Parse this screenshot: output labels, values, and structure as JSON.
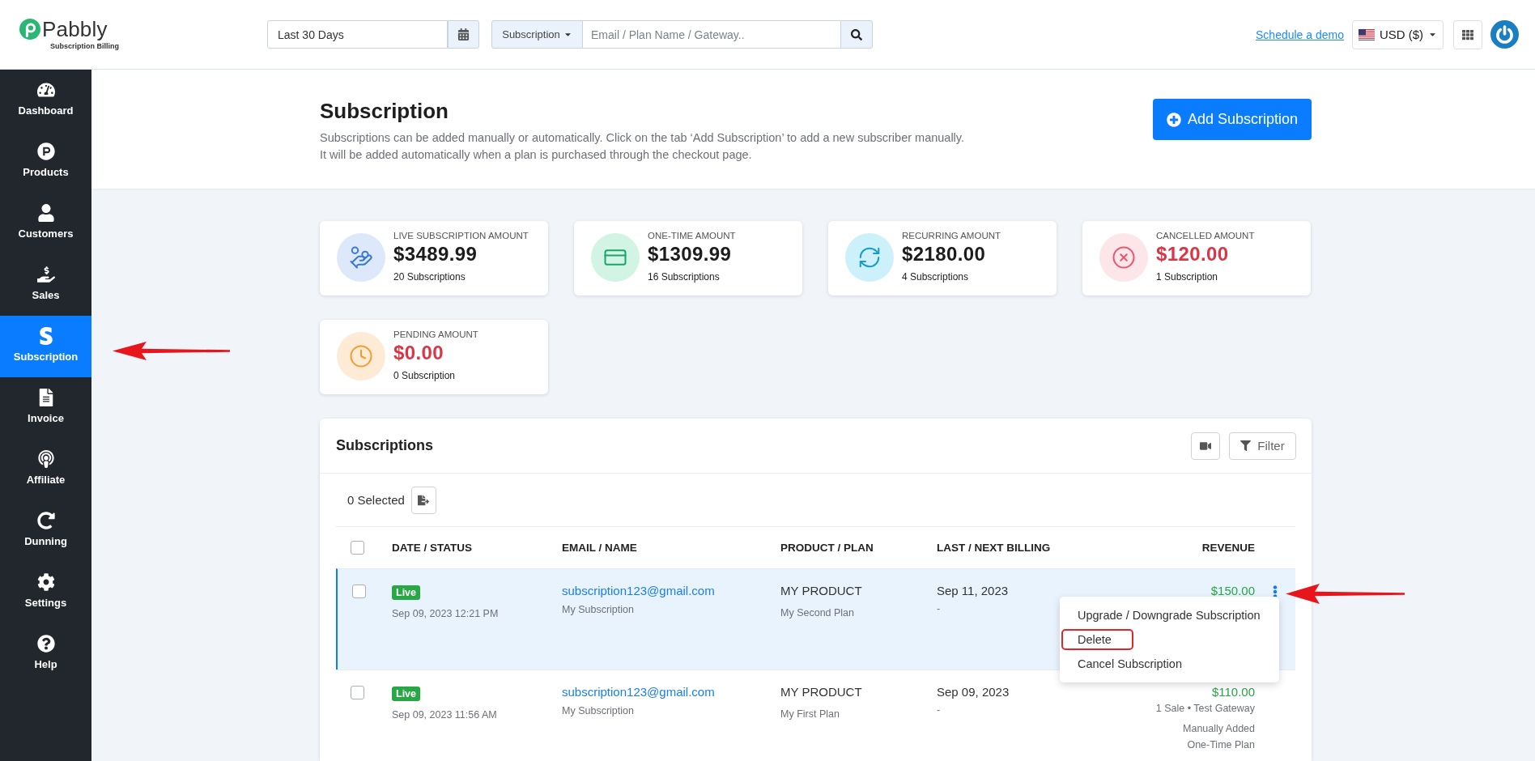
{
  "top_bar": {
    "logo": {
      "name": "Pabbly",
      "tagline": "Subscription Billing"
    },
    "date_range": {
      "value": "Last 30 Days"
    },
    "search": {
      "scope": "Subscription",
      "placeholder": "Email / Plan Name / Gateway.."
    },
    "demo_link": "Schedule a demo",
    "currency": "USD ($)"
  },
  "sidebar": {
    "items": [
      {
        "label": "Dashboard",
        "selected": false,
        "pointer_arrow": false
      },
      {
        "label": "Products",
        "selected": false,
        "pointer_arrow": false
      },
      {
        "label": "Customers",
        "selected": false,
        "pointer_arrow": false
      },
      {
        "label": "Sales",
        "selected": false,
        "pointer_arrow": false
      },
      {
        "label": "Subscription",
        "selected": true,
        "pointer_arrow": true
      },
      {
        "label": "Invoice",
        "selected": false,
        "pointer_arrow": false
      },
      {
        "label": "Affiliate",
        "selected": false,
        "pointer_arrow": false
      },
      {
        "label": "Dunning",
        "selected": false,
        "pointer_arrow": false
      },
      {
        "label": "Settings",
        "selected": false,
        "pointer_arrow": false
      },
      {
        "label": "Help",
        "selected": false,
        "pointer_arrow": false
      }
    ]
  },
  "header": {
    "title": "Subscription",
    "description": [
      "Subscriptions can be added manually or automatically. Click on the tab ‘Add Subscription’ to add a new subscriber manually.",
      "It will be added automatically when a plan is purchased through the checkout page."
    ],
    "add_button": "Add Subscription"
  },
  "stats": [
    {
      "kind": "live",
      "label": "LIVE SUBSCRIPTION AMOUNT",
      "amount": "$3489.99",
      "count": "20 Subscriptions"
    },
    {
      "kind": "one_time",
      "label": "ONE-TIME AMOUNT",
      "amount": "$1309.99",
      "count": "16 Subscriptions"
    },
    {
      "kind": "recurring",
      "label": "RECURRING AMOUNT",
      "amount": "$2180.00",
      "count": "4 Subscriptions"
    },
    {
      "kind": "cancelled",
      "label": "CANCELLED AMOUNT",
      "amount": "$120.00",
      "count": "1 Subscription"
    },
    {
      "kind": "pending",
      "label": "PENDING AMOUNT",
      "amount": "$0.00",
      "count": "0 Subscription"
    }
  ],
  "subscriptions": {
    "title": "Subscriptions",
    "filter_button": "Filter",
    "selected_count": "0 Selected",
    "select_all": {
      "checked": false
    },
    "columns": [
      "DATE / STATUS",
      "EMAIL / NAME",
      "PRODUCT / PLAN",
      "LAST / NEXT BILLING",
      "REVENUE"
    ],
    "rows": [
      {
        "checked": false,
        "highlighted": true,
        "pointer_arrow": true,
        "status": "Live",
        "date": "Sep 09, 2023 12:21 PM",
        "email": "subscription123@gmail.com",
        "name": "My Subscription",
        "product": "MY PRODUCT",
        "plan": "My Second Plan",
        "last_billing": "Sep 11, 2023",
        "next_billing": "-",
        "revenue": "$150.00",
        "menu": [
          {
            "label": "Upgrade / Downgrade Subscription",
            "outlined": false
          },
          {
            "label": "Delete",
            "outlined": true
          },
          {
            "label": "Cancel Subscription",
            "outlined": false
          }
        ]
      },
      {
        "checked": false,
        "highlighted": false,
        "pointer_arrow": false,
        "status": "Live",
        "date": "Sep 09, 2023 11:56 AM",
        "email": "subscription123@gmail.com",
        "name": "My Subscription",
        "product": "MY PRODUCT",
        "plan": "My First Plan",
        "last_billing": "Sep 09, 2023",
        "next_billing": "-",
        "revenue": "$110.00",
        "sale_info": "1 Sale • Test Gateway",
        "origin": "Manually Added",
        "plan_type": "One-Time Plan"
      }
    ]
  }
}
